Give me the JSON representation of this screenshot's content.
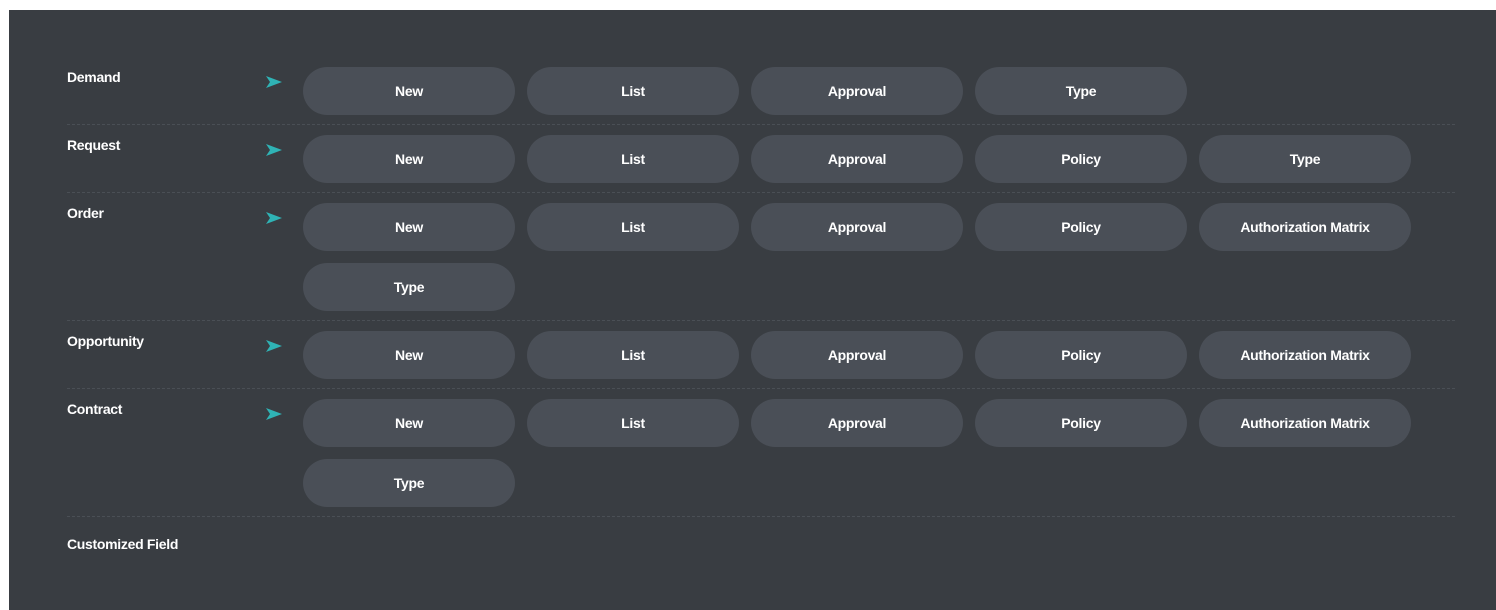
{
  "colors": {
    "panel_background": "#393d42",
    "button_background": "#4a4f57",
    "arrow_accent": "#2fb3b5",
    "text": "#ffffff"
  },
  "rows": [
    {
      "label": "Demand",
      "icon": "arrow-right-icon",
      "buttons": [
        "New",
        "List",
        "Approval",
        "Type"
      ]
    },
    {
      "label": "Request",
      "icon": "arrow-right-icon",
      "buttons": [
        "New",
        "List",
        "Approval",
        "Policy",
        "Type"
      ]
    },
    {
      "label": "Order",
      "icon": "arrow-right-icon",
      "buttons": [
        "New",
        "List",
        "Approval",
        "Policy",
        "Authorization Matrix",
        "Type"
      ]
    },
    {
      "label": "Opportunity",
      "icon": "arrow-right-icon",
      "buttons": [
        "New",
        "List",
        "Approval",
        "Policy",
        "Authorization Matrix"
      ]
    },
    {
      "label": "Contract",
      "icon": "arrow-right-icon",
      "buttons": [
        "New",
        "List",
        "Approval",
        "Policy",
        "Authorization Matrix",
        "Type"
      ]
    }
  ],
  "footer": {
    "label": "Customized Field"
  }
}
